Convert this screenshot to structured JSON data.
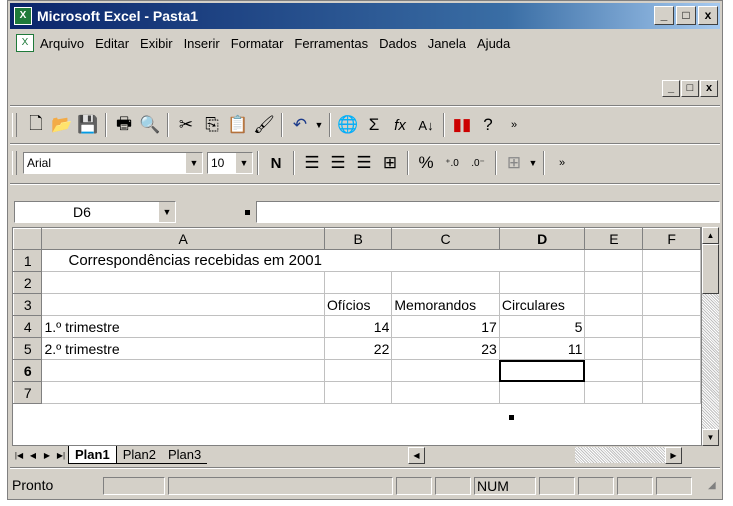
{
  "window": {
    "title": "Microsoft Excel - Pasta1",
    "controls": {
      "minimize": "_",
      "restore": "□",
      "close": "x"
    }
  },
  "menu": [
    "Arquivo",
    "Editar",
    "Exibir",
    "Inserir",
    "Formatar",
    "Ferramentas",
    "Dados",
    "Janela",
    "Ajuda"
  ],
  "toolbar": {
    "font_name": "Arial",
    "font_size": "10",
    "bold_label": "N",
    "percent_label": "%"
  },
  "formula_bar": {
    "name_box": "D6",
    "contents": ""
  },
  "sheet": {
    "columns": [
      "A",
      "B",
      "C",
      "D",
      "E",
      "F"
    ],
    "active_column": "D",
    "active_row": "6",
    "rows": [
      {
        "n": "1",
        "cells": [
          "Correspondências recebidas em 2001",
          "",
          "",
          "",
          "",
          ""
        ]
      },
      {
        "n": "2",
        "cells": [
          "",
          "",
          "",
          "",
          "",
          ""
        ]
      },
      {
        "n": "3",
        "cells": [
          "",
          "Ofícios",
          "Memorandos",
          "Circulares",
          "",
          ""
        ]
      },
      {
        "n": "4",
        "cells": [
          "1.º trimestre",
          "14",
          "17",
          "5",
          "",
          ""
        ]
      },
      {
        "n": "5",
        "cells": [
          "2.º trimestre",
          "22",
          "23",
          "11",
          "",
          ""
        ]
      },
      {
        "n": "6",
        "cells": [
          "",
          "",
          "",
          "",
          "",
          ""
        ]
      },
      {
        "n": "7",
        "cells": [
          "",
          "",
          "",
          "",
          "",
          ""
        ]
      }
    ]
  },
  "tabs": [
    "Plan1",
    "Plan2",
    "Plan3"
  ],
  "active_tab": "Plan1",
  "status": {
    "left": "Pronto",
    "num": "NUM"
  }
}
